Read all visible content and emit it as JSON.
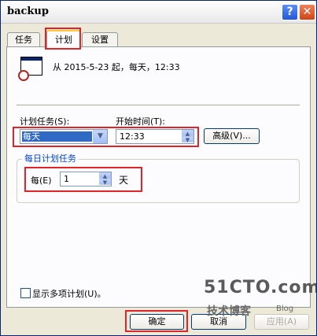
{
  "window": {
    "title": "backup",
    "help_label": "?",
    "close_label": "✕"
  },
  "tabs": [
    {
      "label": "任务"
    },
    {
      "label": "计划"
    },
    {
      "label": "设置"
    }
  ],
  "schedule": {
    "summary": "从 2015-5-23 起，每天，12:33",
    "task_label": "计划任务(S):",
    "task_value": "每天",
    "start_label": "开始时间(T):",
    "start_value": "12:33",
    "advanced_label": "高级(V)..."
  },
  "daily": {
    "group_title": "每日计划任务",
    "every_label": "每(E)",
    "interval_value": "1",
    "unit_label": "天"
  },
  "show_multiple_label": "显示多项计划(U)。",
  "footer": {
    "ok_label": "确定",
    "cancel_label": "取消",
    "apply_label": "应用(A)"
  },
  "watermark": {
    "main": "51CTO.com",
    "sub": "技术博客",
    "blog": "Blog"
  },
  "icons": {
    "dropdown": "▼",
    "spin_up": "▲",
    "spin_down": "▼"
  }
}
